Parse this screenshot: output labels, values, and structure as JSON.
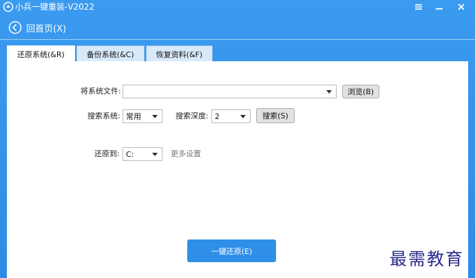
{
  "window": {
    "title": "小兵一键重装-V2022",
    "menu_icon": "hamburger-icon",
    "minimize_icon": "minimize-icon",
    "close_icon": "close-icon"
  },
  "nav": {
    "back_label": "回首页(X)"
  },
  "tabs": [
    {
      "label": "还原系统(&R)",
      "active": true
    },
    {
      "label": "备份系统(&C)",
      "active": false
    },
    {
      "label": "恢复资料(&F)",
      "active": false
    }
  ],
  "restore": {
    "file_label": "将系统文件:",
    "file_value": "",
    "browse_label": "浏览(B)",
    "search_label": "搜索系统:",
    "search_mode": "常用",
    "depth_label": "搜索深度:",
    "depth_value": "2",
    "search_button": "搜索(S)",
    "restore_to_label": "还原到:",
    "restore_to_value": "C:",
    "more_settings": "更多设置",
    "one_key_button": "一键还原(E)"
  },
  "watermark": "最需教育",
  "colors": {
    "accent": "#2f8ce6",
    "primary_button": "#2f8fe8",
    "watermark": "#2a2a8a"
  }
}
